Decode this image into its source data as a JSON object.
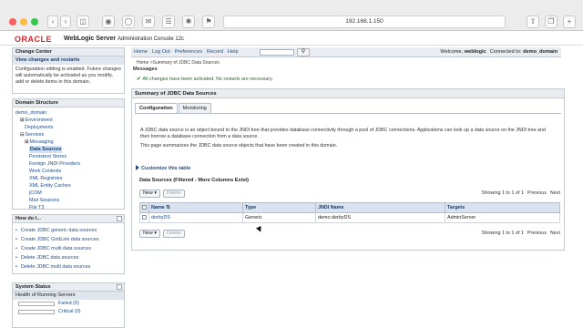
{
  "browser": {
    "address": "192.168.1.150"
  },
  "header": {
    "logo": "ORACLE",
    "product": "WebLogic Server",
    "subtitle": "Administration Console 12c"
  },
  "change_center": {
    "title": "Change Center",
    "subtitle": "View changes and restarts",
    "text": "Configuration editing is enabled. Future changes will automatically be activated as you modify, add or delete items in this domain."
  },
  "domain_structure": {
    "title": "Domain Structure",
    "items": [
      {
        "label": "demo_domain",
        "indent": 0,
        "prefix": ""
      },
      {
        "label": "Environment",
        "indent": 1,
        "prefix": "⊞"
      },
      {
        "label": "Deployments",
        "indent": 2,
        "prefix": ""
      },
      {
        "label": "Services",
        "indent": 1,
        "prefix": "⊟"
      },
      {
        "label": "Messaging",
        "indent": 2,
        "prefix": "⊞"
      },
      {
        "label": "Data Sources",
        "indent": 3,
        "prefix": "",
        "selected": true
      },
      {
        "label": "Persistent Stores",
        "indent": 3,
        "prefix": ""
      },
      {
        "label": "Foreign JNDI Providers",
        "indent": 3,
        "prefix": ""
      },
      {
        "label": "Work Contexts",
        "indent": 3,
        "prefix": ""
      },
      {
        "label": "XML Registries",
        "indent": 3,
        "prefix": ""
      },
      {
        "label": "XML Entity Caches",
        "indent": 3,
        "prefix": ""
      },
      {
        "label": "jCOM",
        "indent": 3,
        "prefix": ""
      },
      {
        "label": "Mail Sessions",
        "indent": 3,
        "prefix": ""
      },
      {
        "label": "File T3",
        "indent": 3,
        "prefix": ""
      }
    ]
  },
  "how_do_i": {
    "title": "How do I...",
    "items": [
      "Create JDBC generic data sources",
      "Create JDBC GridLink data sources",
      "Create JDBC multi data sources",
      "Delete JDBC data sources",
      "Delete JDBC multi data sources"
    ]
  },
  "system_status": {
    "title": "System Status",
    "subtitle": "Health of Running Servers",
    "rows": [
      "Failed (0)",
      "Critical (0)"
    ]
  },
  "toolbar": {
    "links": [
      "Home",
      "Log Out",
      "Preferences",
      "Record",
      "Help"
    ],
    "welcome_prefix": "Welcome, ",
    "user": "weblogic",
    "connected_prefix": "Connected to: ",
    "domain": "demo_domain"
  },
  "breadcrumb": "Home >Summary of JDBC Data Sources",
  "messages": {
    "title": "Messages",
    "text": "All changes have been activated. No restarts are necessary."
  },
  "summary": {
    "title": "Summary of JDBC Data Sources",
    "tabs": [
      "Configuration",
      "Monitoring"
    ],
    "desc1": "A JDBC data source is an object bound to the JNDI tree that provides database connectivity through a pool of JDBC connections. Applications can look up a data source on the JNDI tree and then borrow a database connection from a data source.",
    "desc2": "This page summarizes the JDBC data source objects that have been created in this domain.",
    "customize": "Customize this table",
    "table_title": "Data Sources (Filtered - More Columns Exist)",
    "new_label": "New",
    "delete_label": "Delete",
    "pager_text": "Showing 1 to 1 of 1",
    "previous": "Previous",
    "next": "Next",
    "columns": [
      "Name",
      "Type",
      "JNDI Name",
      "Targets"
    ],
    "rows": [
      {
        "name": "derbyDS",
        "type": "Generic",
        "jndi": "demo.derbyDS",
        "targets": "AdminServer"
      }
    ]
  }
}
